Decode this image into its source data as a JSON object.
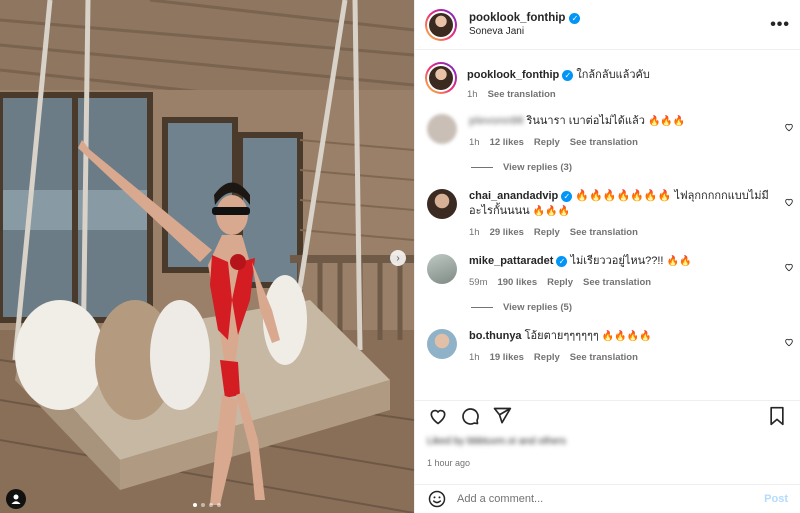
{
  "post": {
    "username": "pooklook_fonthip",
    "location": "Soneva Jani",
    "more_label": "•••",
    "carousel_dots": 4,
    "active_dot": 0
  },
  "caption": {
    "username": "pooklook_fonthip",
    "text": "ใกล้กลับแล้วคับ",
    "time": "1h",
    "see_translation": "See translation"
  },
  "comments": [
    {
      "username": "plevonn98",
      "username_blurred": true,
      "text": "รินนารา เบาต่อไม่ได้แล้ว",
      "emoji": "🔥🔥🔥",
      "time": "1h",
      "likes": "12 likes",
      "reply": "Reply",
      "see_translation": "See translation",
      "view_replies": "View replies (3)",
      "verified": false,
      "avatar_color": "#c9bfb7"
    },
    {
      "username": "chai_anandadvip",
      "text": "🔥🔥🔥🔥🔥🔥🔥 ไฟลุกกกกกแบบไม่มีอะไรกั้นนนน",
      "emoji": "🔥🔥🔥",
      "time": "1h",
      "likes": "29 likes",
      "reply": "Reply",
      "see_translation": "See translation",
      "verified": true,
      "avatar_color": "#5a3b2c"
    },
    {
      "username": "mike_pattaradet",
      "text": "ไม่เรียววอยู่ไหน??!!",
      "emoji": "🔥🔥",
      "time": "59m",
      "likes": "190 likes",
      "reply": "Reply",
      "see_translation": "See translation",
      "view_replies": "View replies (5)",
      "verified": true,
      "avatar_color": "#9fa9a3"
    },
    {
      "username": "bo.thunya",
      "text": "โอ้ยตายๆๆๆๆๆๆ",
      "emoji": "🔥🔥🔥🔥",
      "time": "1h",
      "likes": "19 likes",
      "reply": "Reply",
      "see_translation": "See translation",
      "verified": false,
      "avatar_color": "#a9c6d8"
    }
  ],
  "liked_by": "Liked by bbbtuvm.st and others",
  "timestamp": "1 hour ago",
  "add_comment": {
    "placeholder": "Add a comment...",
    "post_label": "Post"
  },
  "icons": {
    "like": "heart-icon",
    "comment": "comment-icon",
    "share": "share-icon",
    "save": "bookmark-icon",
    "emoji": "emoji-icon",
    "more": "more-icon",
    "next": "chevron-right-icon",
    "tag": "user-tag-icon"
  },
  "colors": {
    "verified": "#0095f6",
    "muted": "#737373",
    "text": "#262626",
    "post_disabled": "#b3dbff"
  }
}
